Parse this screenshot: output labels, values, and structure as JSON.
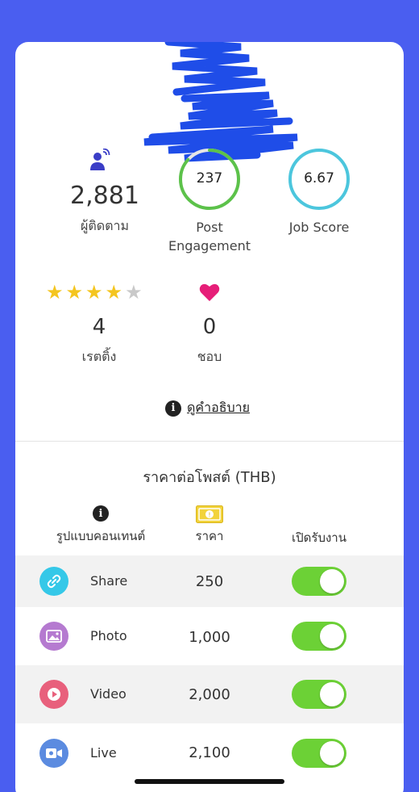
{
  "stats": {
    "followers": {
      "value": "2,881",
      "label": "ผู้ติดตาม"
    },
    "post_engagement": {
      "value": "237",
      "label_line1": "Post",
      "label_line2": "Engagement",
      "ring_color": "#5cc24a"
    },
    "job_score": {
      "value": "6.67",
      "label": "Job Score",
      "ring_color": "#4cc6dd"
    },
    "rating": {
      "value": "4",
      "label": "เรตติ้ง",
      "stars_filled": 4,
      "stars_total": 5
    },
    "likes": {
      "value": "0",
      "label": "ชอบ"
    }
  },
  "explain_link": "ดูคำอธิบาย",
  "pricing": {
    "title": "ราคาต่อโพสต์ (THB)",
    "columns": {
      "content_type": "รูปแบบคอนเทนต์",
      "price": "ราคา",
      "open": "เปิดรับงาน"
    },
    "rows": [
      {
        "type": "Share",
        "price": "250",
        "enabled": true,
        "icon": "link-icon",
        "icon_color": "#35c8e8"
      },
      {
        "type": "Photo",
        "price": "1,000",
        "enabled": true,
        "icon": "image-icon",
        "icon_color": "#b57ad0"
      },
      {
        "type": "Video",
        "price": "2,000",
        "enabled": true,
        "icon": "play-icon",
        "icon_color": "#e8607c"
      },
      {
        "type": "Live",
        "price": "2,100",
        "enabled": true,
        "icon": "live-video-icon",
        "icon_color": "#5b8be0"
      }
    ]
  },
  "colors": {
    "background": "#4a5ef0",
    "toggle_on": "#6cd136",
    "star": "#f4c51f",
    "heart": "#e61e78"
  }
}
